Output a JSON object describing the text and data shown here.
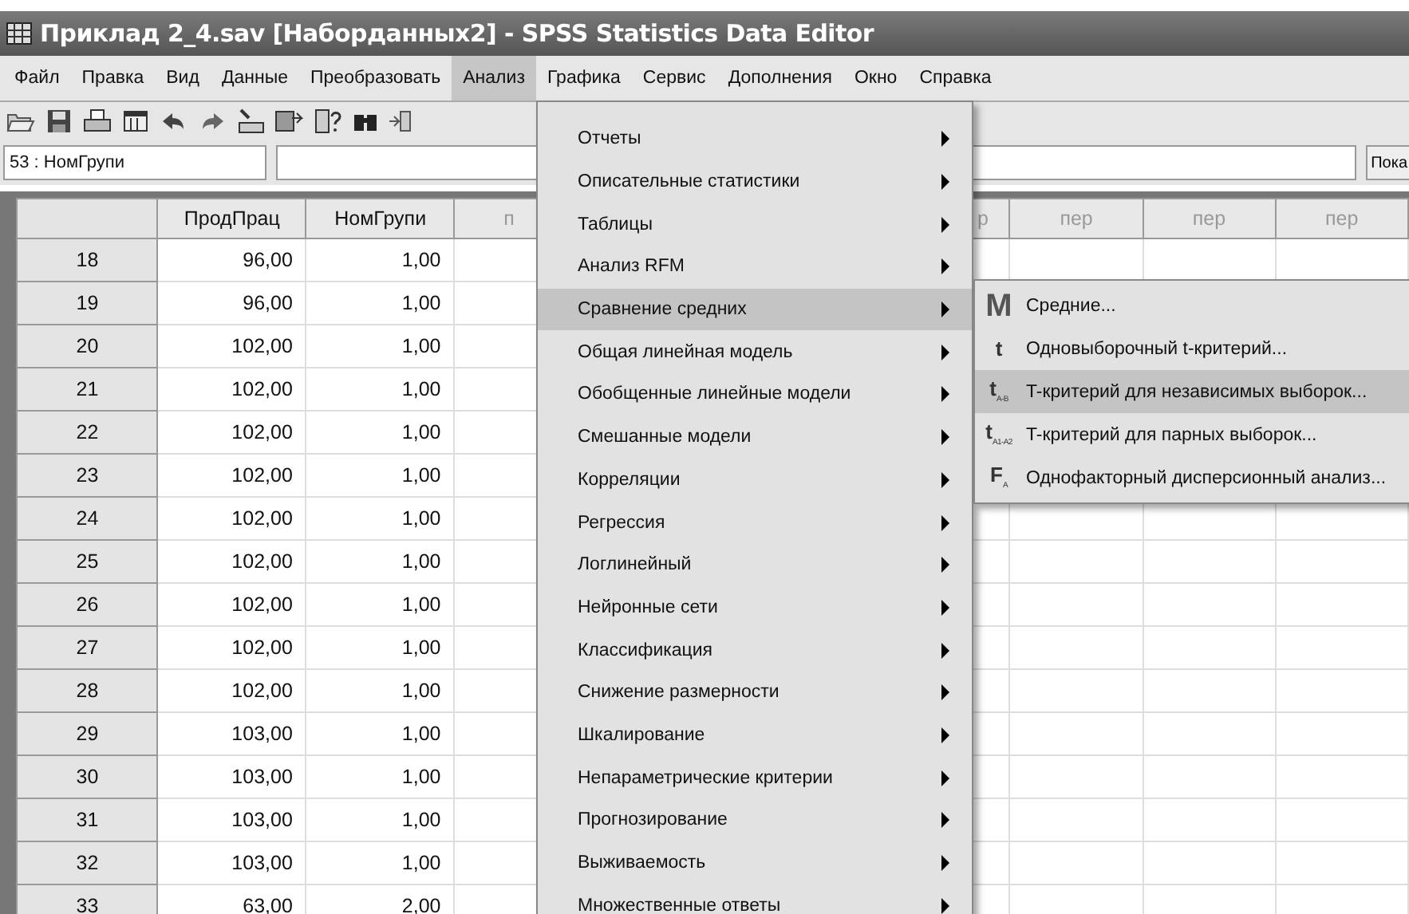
{
  "window": {
    "title": "Приклад 2_4.sav [Наборданных2] - SPSS Statistics Data Editor"
  },
  "menubar": [
    {
      "label": "Файл",
      "selected": false
    },
    {
      "label": "Правка",
      "selected": false
    },
    {
      "label": "Вид",
      "selected": false
    },
    {
      "label": "Данные",
      "selected": false
    },
    {
      "label": "Преобразовать",
      "selected": false
    },
    {
      "label": "Анализ",
      "selected": true
    },
    {
      "label": "Графика",
      "selected": false
    },
    {
      "label": "Сервис",
      "selected": false
    },
    {
      "label": "Дополнения",
      "selected": false
    },
    {
      "label": "Окно",
      "selected": false
    },
    {
      "label": "Справка",
      "selected": false
    }
  ],
  "cell_editor": {
    "cell_label": "53 : НомГрупи",
    "button_label": "Пока"
  },
  "grid": {
    "columns": [
      "ПродПрац",
      "НомГрупи"
    ],
    "cut_column_left": "п",
    "cut_column_right": "р",
    "empty_columns": [
      "пер",
      "пер",
      "пер"
    ],
    "rows": [
      {
        "case": "18",
        "cells": [
          "96,00",
          "1,00"
        ]
      },
      {
        "case": "19",
        "cells": [
          "96,00",
          "1,00"
        ]
      },
      {
        "case": "20",
        "cells": [
          "102,00",
          "1,00"
        ]
      },
      {
        "case": "21",
        "cells": [
          "102,00",
          "1,00"
        ]
      },
      {
        "case": "22",
        "cells": [
          "102,00",
          "1,00"
        ]
      },
      {
        "case": "23",
        "cells": [
          "102,00",
          "1,00"
        ]
      },
      {
        "case": "24",
        "cells": [
          "102,00",
          "1,00"
        ]
      },
      {
        "case": "25",
        "cells": [
          "102,00",
          "1,00"
        ]
      },
      {
        "case": "26",
        "cells": [
          "102,00",
          "1,00"
        ]
      },
      {
        "case": "27",
        "cells": [
          "102,00",
          "1,00"
        ]
      },
      {
        "case": "28",
        "cells": [
          "102,00",
          "1,00"
        ]
      },
      {
        "case": "29",
        "cells": [
          "103,00",
          "1,00"
        ]
      },
      {
        "case": "30",
        "cells": [
          "103,00",
          "1,00"
        ]
      },
      {
        "case": "31",
        "cells": [
          "103,00",
          "1,00"
        ]
      },
      {
        "case": "32",
        "cells": [
          "103,00",
          "1,00"
        ]
      },
      {
        "case": "33",
        "cells": [
          "63,00",
          "2,00"
        ]
      }
    ]
  },
  "analysis_menu": [
    {
      "label": "Отчеты",
      "selected": false
    },
    {
      "label": "Описательные статистики",
      "selected": false
    },
    {
      "label": "Таблицы",
      "selected": false
    },
    {
      "label": "Анализ RFM",
      "selected": false
    },
    {
      "label": "Сравнение средних",
      "selected": true
    },
    {
      "label": "Общая линейная модель",
      "selected": false
    },
    {
      "label": "Обобщенные линейные модели",
      "selected": false
    },
    {
      "label": "Смешанные модели",
      "selected": false
    },
    {
      "label": "Корреляции",
      "selected": false
    },
    {
      "label": "Регрессия",
      "selected": false
    },
    {
      "label": "Логлинейный",
      "selected": false
    },
    {
      "label": "Нейронные сети",
      "selected": false
    },
    {
      "label": "Классификация",
      "selected": false
    },
    {
      "label": "Снижение размерности",
      "selected": false
    },
    {
      "label": "Шкалирование",
      "selected": false
    },
    {
      "label": "Непараметрические критерии",
      "selected": false
    },
    {
      "label": "Прогнозирование",
      "selected": false
    },
    {
      "label": "Выживаемость",
      "selected": false
    },
    {
      "label": "Множественные ответы",
      "selected": false
    }
  ],
  "submenu": [
    {
      "icon": "M",
      "label": "Средние...",
      "selected": false
    },
    {
      "icon": "t",
      "label": "Одновыборочный t-критерий...",
      "selected": false
    },
    {
      "icon": "t$_{A-B}$",
      "label": "T-критерий для независимых выборок...",
      "selected": true
    },
    {
      "icon": "t$_{A1-A2}$",
      "label": "T-критерий для парных выборок...",
      "selected": false
    },
    {
      "icon": "F$_{A}$",
      "label": "Однофакторный дисперсионный анализ...",
      "selected": false
    }
  ]
}
